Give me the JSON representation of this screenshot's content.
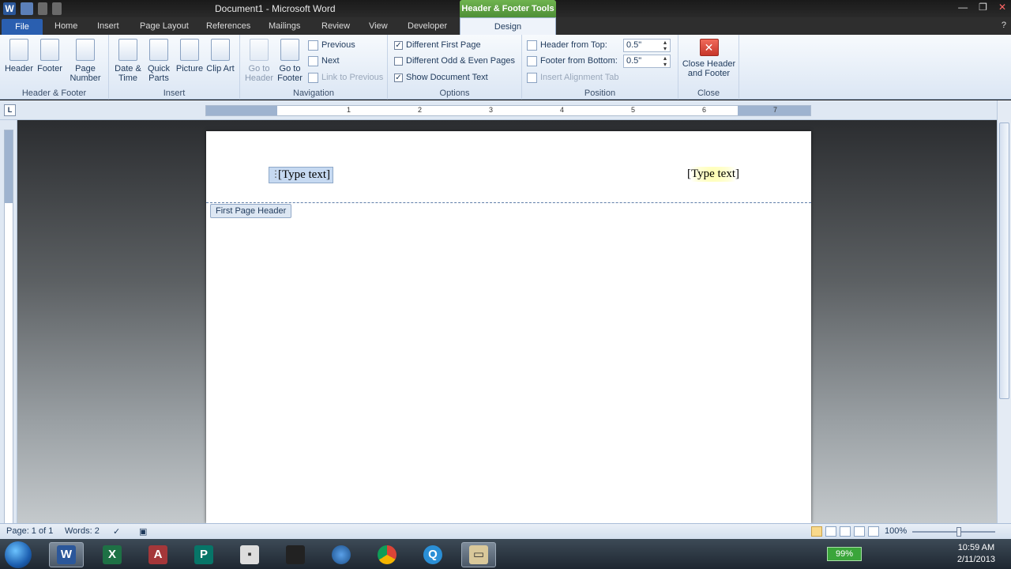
{
  "window": {
    "title": "Document1 - Microsoft Word",
    "contextual_tab_group": "Header & Footer Tools"
  },
  "tabs": [
    "File",
    "Home",
    "Insert",
    "Page Layout",
    "References",
    "Mailings",
    "Review",
    "View",
    "Developer",
    "Design"
  ],
  "ribbon": {
    "header_footer": {
      "label": "Header & Footer",
      "header": "Header",
      "footer": "Footer",
      "page_number": "Page Number"
    },
    "insert": {
      "label": "Insert",
      "date_time": "Date & Time",
      "quick_parts": "Quick Parts",
      "picture": "Picture",
      "clip_art": "Clip Art"
    },
    "navigation": {
      "label": "Navigation",
      "go_to_header": "Go to Header",
      "go_to_footer": "Go to Footer",
      "previous": "Previous",
      "next": "Next",
      "link_to_previous": "Link to Previous"
    },
    "options": {
      "label": "Options",
      "different_first_page": "Different First Page",
      "different_first_page_checked": true,
      "different_odd_even": "Different Odd & Even Pages",
      "different_odd_even_checked": false,
      "show_document_text": "Show Document Text",
      "show_document_text_checked": true
    },
    "position": {
      "label": "Position",
      "header_from_top_label": "Header from Top:",
      "header_from_top_value": "0.5\"",
      "footer_from_bottom_label": "Footer from Bottom:",
      "footer_from_bottom_value": "0.5\"",
      "insert_alignment_tab": "Insert Alignment Tab"
    },
    "close": {
      "label": "Close",
      "close_header_footer": "Close Header and Footer"
    }
  },
  "ruler": {
    "tab_selector": "L",
    "numbers": [
      "1",
      "2",
      "3",
      "4",
      "5",
      "6",
      "7"
    ]
  },
  "document": {
    "header_left_placeholder": "[Type text]",
    "header_right_placeholder": "[Type text]",
    "header_tag": "First Page Header"
  },
  "statusbar": {
    "page": "Page: 1 of 1",
    "words": "Words: 2",
    "zoom": "100%"
  },
  "taskbar": {
    "battery": "99%",
    "time": "10:59 AM",
    "date": "2/11/2013"
  }
}
